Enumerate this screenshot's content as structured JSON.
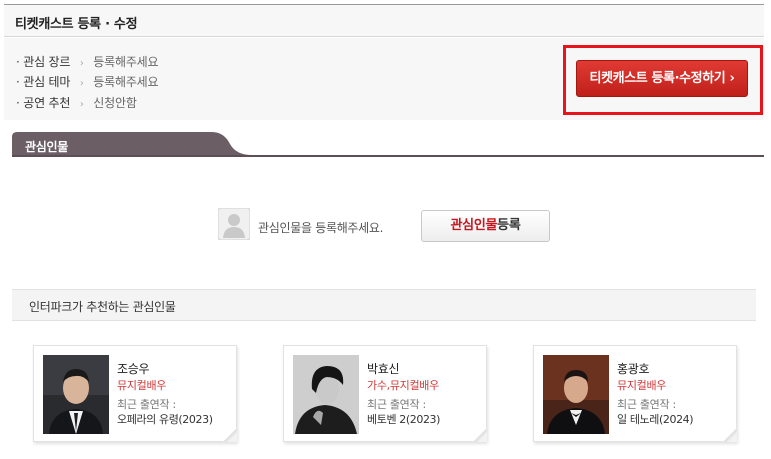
{
  "header": {
    "title": "티켓캐스트 등록 · 수정"
  },
  "info": {
    "rows": [
      {
        "bullet": "·",
        "label": "관심 장르",
        "sep": "›",
        "value": "등록해주세요"
      },
      {
        "bullet": "·",
        "label": "관심 테마",
        "sep": "›",
        "value": "등록해주세요"
      },
      {
        "bullet": "·",
        "label": "공연 추천",
        "sep": "›",
        "value": "신청안함"
      }
    ],
    "cast_button": "티켓캐스트 등록·수정하기 ›"
  },
  "tab": {
    "label": "관심인물"
  },
  "empty": {
    "message": "관심인물을 등록해주세요.",
    "register_button_red": "관심인물",
    "register_button_rest": "등록"
  },
  "recommend": {
    "title": "인터파크가 추천하는 관심인물",
    "people": [
      {
        "name": "조승우",
        "role": "뮤지컬배우",
        "recent_label": "최근 출연작 :",
        "recent_work": "오페라의 유령(2023)"
      },
      {
        "name": "박효신",
        "role": "가수,뮤지컬배우",
        "recent_label": "최근 출연작 :",
        "recent_work": "베토벤 2(2023)"
      },
      {
        "name": "홍광호",
        "role": "뮤지컬배우",
        "recent_label": "최근 출연작 :",
        "recent_work": "일 테노레(2024)"
      }
    ]
  },
  "colors": {
    "accent_red": "#c4171f",
    "highlight_red": "#e8141c",
    "tab_bg": "#6b5e65"
  }
}
